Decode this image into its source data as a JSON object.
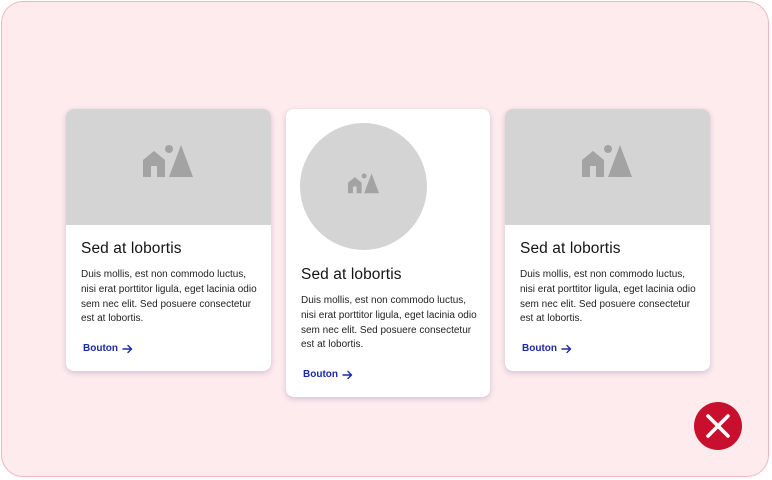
{
  "cards": [
    {
      "title": "Sed at lobortis",
      "body": "Duis mollis, est non commodo luctus, nisi erat porttitor ligula, eget lacinia odio sem nec elit. Sed posuere consectetur est at lobortis.",
      "button_label": "Bouton",
      "image_icon": "image-placeholder-icon",
      "image_shape": "rectangle"
    },
    {
      "title": "Sed at lobortis",
      "body": "Duis mollis, est non commodo luctus, nisi erat porttitor ligula, eget lacinia odio sem nec elit. Sed posuere consectetur est at lobortis.",
      "button_label": "Bouton",
      "image_icon": "image-placeholder-icon",
      "image_shape": "circle"
    },
    {
      "title": "Sed at lobortis",
      "body": "Duis mollis, est non commodo luctus, nisi erat porttitor ligula, eget lacinia odio sem nec elit. Sed posuere consectetur est at lobortis.",
      "button_label": "Bouton",
      "image_icon": "image-placeholder-icon",
      "image_shape": "rectangle"
    }
  ],
  "status_icon": "close-icon",
  "colors": {
    "frame_background": "#fdebee",
    "frame_border": "#efb7bf",
    "image_placeholder": "#d4d4d4",
    "placeholder_icon": "#a3a3a3",
    "link": "#1b2aa8",
    "error": "#c8102e"
  }
}
